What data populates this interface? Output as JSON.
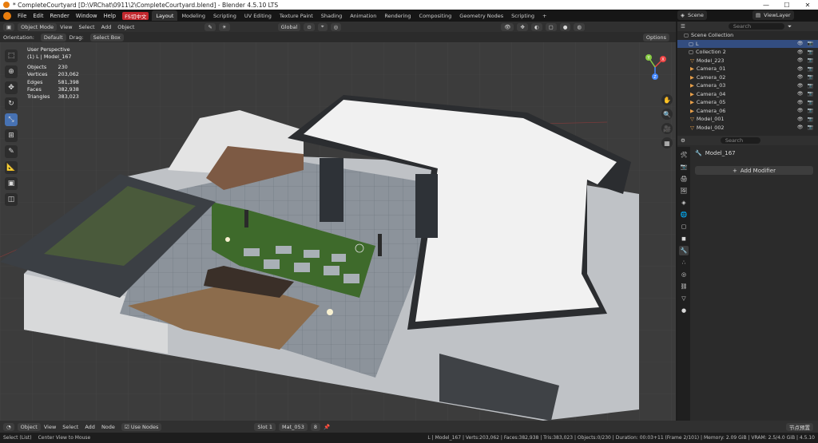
{
  "window": {
    "title": "* CompleteCourtyard [D:\\VRChat\\0911\\2\\CompleteCourtyard.blend] - Blender 4.5.10 LTS"
  },
  "menu": {
    "items": [
      "File",
      "Edit",
      "Render",
      "Window",
      "Help"
    ],
    "lang_badge": "FS切中文"
  },
  "workspaces": [
    "Layout",
    "Modeling",
    "Scripting",
    "UV Editing",
    "Texture Paint",
    "Shading",
    "Animation",
    "Rendering",
    "Compositing",
    "Geometry Nodes",
    "Scripting"
  ],
  "scene": {
    "label": "Scene",
    "view_layer": "ViewLayer"
  },
  "viewport_header": {
    "mode": "Object Mode",
    "view": "View",
    "select": "Select",
    "add": "Add",
    "object": "Object",
    "transform": "Global",
    "options": "Options",
    "orientation_label": "Orientation:",
    "orientation_value": "Default",
    "drag_label": "Drag:",
    "drag_value": "Select Box"
  },
  "overlay": {
    "perspective": "User Perspective",
    "active": "(1) L | Model_167",
    "stats": [
      {
        "k": "Objects",
        "v": "230"
      },
      {
        "k": "Vertices",
        "v": "203,062"
      },
      {
        "k": "Edges",
        "v": "581,398"
      },
      {
        "k": "Faces",
        "v": "382,938"
      },
      {
        "k": "Triangles",
        "v": "383,023"
      }
    ]
  },
  "gizmo": {
    "x": "X",
    "y": "Y",
    "z": "Z"
  },
  "outliner": {
    "search_placeholder": "Search",
    "root": "Scene Collection",
    "rows": [
      {
        "name": "L",
        "selected": true
      },
      {
        "name": "Collection 2",
        "selected": false
      },
      {
        "name": "Model_223",
        "selected": false
      },
      {
        "name": "Camera_01",
        "selected": false
      },
      {
        "name": "Camera_02",
        "selected": false
      },
      {
        "name": "Camera_03",
        "selected": false
      },
      {
        "name": "Camera_04",
        "selected": false
      },
      {
        "name": "Camera_05",
        "selected": false
      },
      {
        "name": "Camera_06",
        "selected": false
      },
      {
        "name": "Model_001",
        "selected": false
      },
      {
        "name": "Model_002",
        "selected": false
      }
    ]
  },
  "properties": {
    "search_placeholder": "Search",
    "object_name": "Model_167",
    "add_modifier": "Add Modifier"
  },
  "bottom_header": {
    "editor": "Object",
    "view": "View",
    "select": "Select",
    "add": "Add",
    "node": "Node",
    "use_nodes": "Use Nodes",
    "slot": "Slot 1",
    "material": "Mat_053",
    "users": "8",
    "right_label": "节点预置"
  },
  "statusbar": {
    "left1": "Select (List)",
    "left2": "Center View to Mouse",
    "right": "L | Model_167 | Verts:203,062 | Faces:382,938 | Tris:383,023 | Objects:0/230 | Duration: 00:03+11 (Frame 2/101) | Memory: 2.09 GiB | VRAM: 2.5/4.0 GiB | 4.5.10"
  },
  "colors": {
    "accent": "#4772b3",
    "blender_orange": "#e87d0d",
    "selection": "#334d80"
  }
}
